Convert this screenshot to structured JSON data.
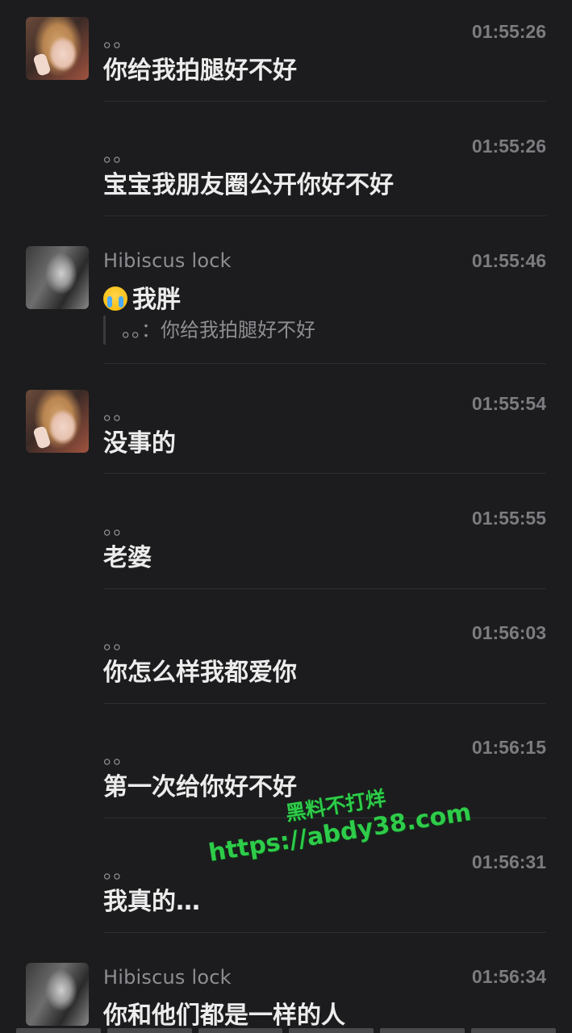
{
  "messages": [
    {
      "sender": "。。",
      "time": "01:55:26",
      "text": "你给我拍腿好不好",
      "avatar": "girl-avatar"
    },
    {
      "sender": "。。",
      "time": "01:55:26",
      "text": "宝宝我朋友圈公开你好不好"
    },
    {
      "sender": "Hibiscus lock",
      "time": "01:55:46",
      "emoji": "crying-face-icon",
      "text": "我胖",
      "avatar": "bw-avatar",
      "quote": {
        "sender": "。。：",
        "text": "你给我拍腿好不好"
      }
    },
    {
      "sender": "。。",
      "time": "01:55:54",
      "text": "没事的",
      "avatar": "girl-avatar"
    },
    {
      "sender": "。。",
      "time": "01:55:55",
      "text": "老婆"
    },
    {
      "sender": "。。",
      "time": "01:56:03",
      "text": "你怎么样我都爱你"
    },
    {
      "sender": "。。",
      "time": "01:56:15",
      "text": "第一次给你好不好"
    },
    {
      "sender": "。。",
      "time": "01:56:31",
      "text": "我真的…"
    },
    {
      "sender": "Hibiscus lock",
      "time": "01:56:34",
      "text": "你和他们都是一样的人",
      "avatar": "bw-avatar"
    }
  ],
  "watermark": {
    "line1": "黑料不打烊",
    "line2": "https://abdy38.com",
    "color": "#2ecc4a"
  }
}
